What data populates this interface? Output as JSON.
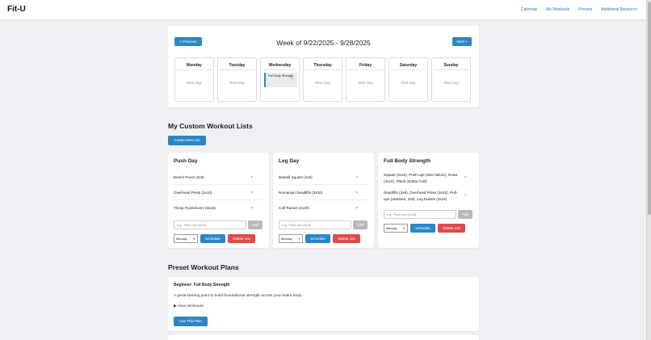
{
  "app": {
    "logo": "Fit-U"
  },
  "nav": {
    "items": [
      "Calendar",
      "My Workouts",
      "Presets",
      "Additional Resource"
    ]
  },
  "calendar": {
    "prev_label": "< Previous",
    "next_label": "Next >",
    "week_title": "Week of 9/22/2025 - 9/28/2025",
    "days": [
      {
        "name": "Monday",
        "rest": "Rest Day"
      },
      {
        "name": "Tuesday",
        "rest": "Rest Day"
      },
      {
        "name": "Wednesday",
        "workout": "Full Body Strength"
      },
      {
        "name": "Thursday",
        "rest": "Rest Day"
      },
      {
        "name": "Friday",
        "rest": "Rest Day"
      },
      {
        "name": "Saturday",
        "rest": "Rest Day"
      },
      {
        "name": "Sunday",
        "rest": "Rest Day"
      }
    ],
    "remove_glyph": "×"
  },
  "custom_lists": {
    "title": "My Custom Workout Lists",
    "create_label": "Create New List",
    "input_placeholder": "e.g., Push-ups (3x15)",
    "add_label": "Add",
    "schedule_label": "Schedule",
    "delete_label": "Delete List",
    "selected_day": "Monday",
    "lists": [
      {
        "name": "Push Day",
        "exercises": [
          "Bench Press (3x8)",
          "Overhead Press (3x10)",
          "Tricep Pushdowns (3x15)"
        ]
      },
      {
        "name": "Leg Day",
        "exercises": [
          "Barbell Squats (4x6)",
          "Romanian Deadlifts (3x10)",
          "Calf Raises (4x20)"
        ]
      },
      {
        "name": "Full Body Strength",
        "exercises": [
          "Squats (3x10), Push-ups (3xto failure), Rows (3x10), Plank (3x30s hold)",
          "Deadlifts (3x8), Overhead Press (3x10), Pull-ups (assisted, 3x8), Leg Raises (3x15)"
        ]
      }
    ]
  },
  "presets": {
    "title": "Preset Workout Plans",
    "plan": {
      "name": "Beginner: Full Body Strength",
      "description": "A great starting point to build foundational strength across your entire body.",
      "view_label": "▶ View Workouts",
      "use_label": "Use This Plan"
    }
  },
  "colors": {
    "accent": "#2b86c5",
    "danger": "#e04a4a",
    "background": "#eef0f3"
  }
}
